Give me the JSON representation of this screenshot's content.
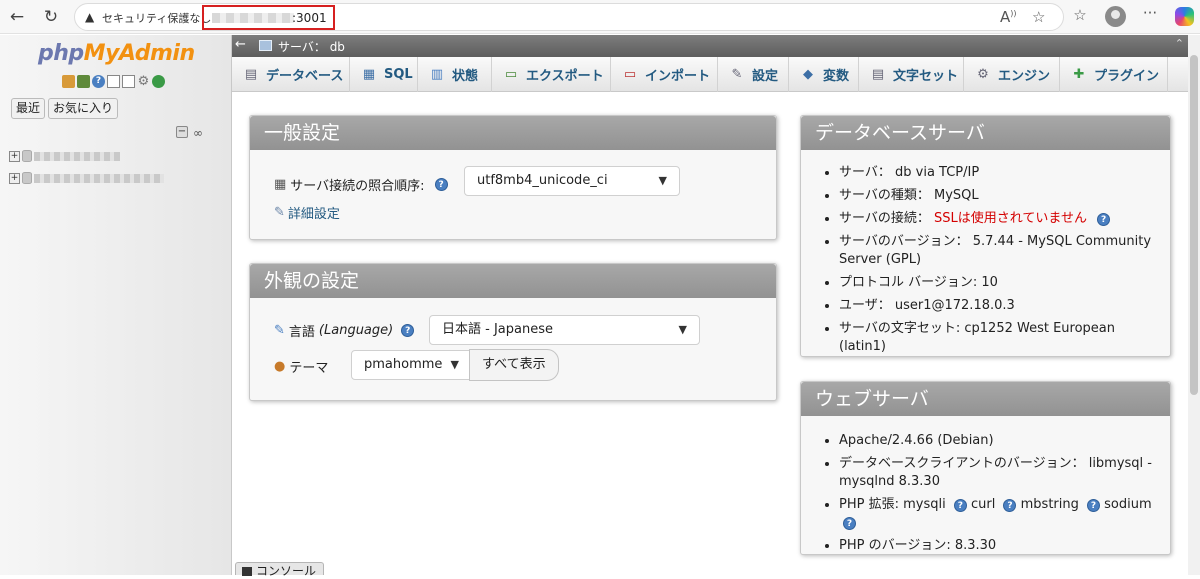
{
  "browser": {
    "security_text": "セキュリティ保護なし",
    "url_port": ":3001"
  },
  "left": {
    "logo_php": "php",
    "logo_rest": "MyAdmin",
    "tab_recent": "最近",
    "tab_favorites": "お気に入り"
  },
  "breadcrumb": {
    "server_label": "サーバ： db"
  },
  "menu": {
    "tabs": [
      {
        "label": "データベース",
        "icon": "database-icon"
      },
      {
        "label": "SQL",
        "icon": "sql-icon"
      },
      {
        "label": "状態",
        "icon": "status-icon"
      },
      {
        "label": "エクスポート",
        "icon": "export-icon"
      },
      {
        "label": "インポート",
        "icon": "import-icon"
      },
      {
        "label": "設定",
        "icon": "wrench-icon"
      },
      {
        "label": "変数",
        "icon": "variables-icon"
      },
      {
        "label": "文字セット",
        "icon": "charset-icon"
      },
      {
        "label": "エンジン",
        "icon": "engine-icon"
      },
      {
        "label": "プラグイン",
        "icon": "plugin-icon"
      }
    ]
  },
  "general": {
    "title": "一般設定",
    "collation_label": "サーバ接続の照合順序:",
    "collation_value": "utf8mb4_unicode_ci",
    "more_settings": "詳細設定"
  },
  "appearance": {
    "title": "外観の設定",
    "language_label": "言語",
    "language_label_en": "(Language)",
    "language_value": "日本語 - Japanese",
    "theme_label": "テーマ",
    "theme_value": "pmahomme",
    "view_all": "すべて表示"
  },
  "dbserver": {
    "title": "データベースサーバ",
    "items": [
      "サーバ： db via TCP/IP",
      "サーバの種類： MySQL",
      "サーバの接続：",
      "サーバのバージョン： 5.7.44 - MySQL Community Server (GPL)",
      "プロトコル バージョン: 10",
      "ユーザ： user1@172.18.0.3",
      "サーバの文字セット: cp1252 West European (latin1)"
    ],
    "ssl_value": "SSLは使用されていません"
  },
  "webserver": {
    "title": "ウェブサーバ",
    "items": [
      "Apache/2.4.66 (Debian)",
      "データベースクライアントのバージョン： libmysql - mysqlnd 8.3.30",
      "PHP 拡張: mysqli",
      "PHP のバージョン: 8.3.30"
    ],
    "ext_curl": "curl",
    "ext_mbstring": "mbstring",
    "ext_sodium": "sodium"
  },
  "console": {
    "label": "コンソール"
  }
}
